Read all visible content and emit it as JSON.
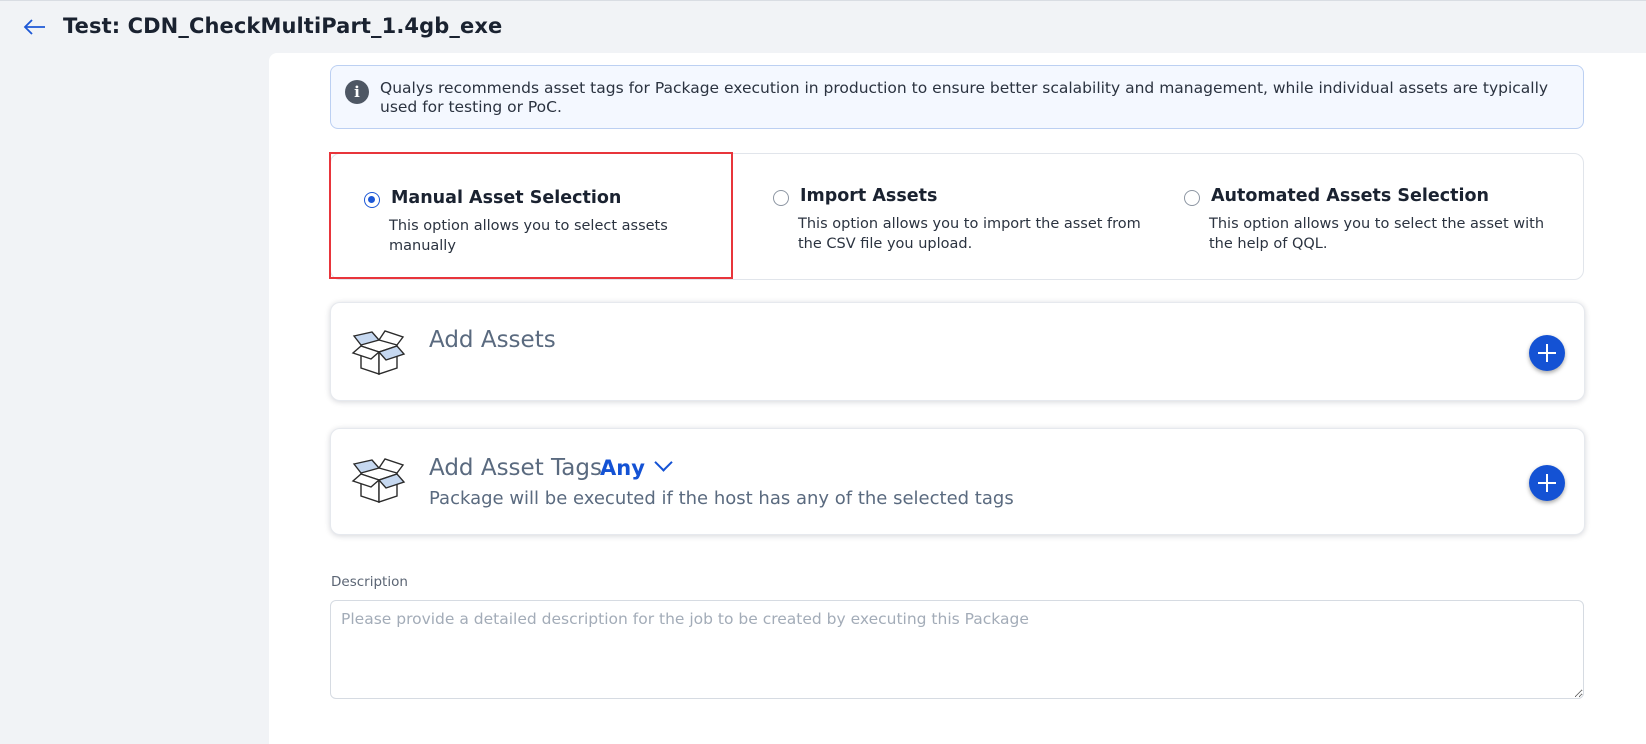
{
  "header": {
    "title": "Test: CDN_CheckMultiPart_1.4gb_exe",
    "back_icon": "arrow-left-icon"
  },
  "info_banner": {
    "icon": "info-icon",
    "text": "Qualys recommends asset tags for Package execution in production to ensure better scalability and management, while individual assets are typically used for testing or PoC."
  },
  "selection_options": [
    {
      "title": "Manual Asset Selection",
      "description": "This option allows you to select assets manually",
      "selected": true
    },
    {
      "title": "Import Assets",
      "description": "This option allows you to import the asset from the CSV file you upload.",
      "selected": false
    },
    {
      "title": "Automated Assets Selection",
      "description": "This option allows you to select the asset with the help of QQL.",
      "selected": false
    }
  ],
  "add_assets": {
    "title": "Add Assets",
    "icon": "open-box-icon",
    "button_icon": "plus-icon"
  },
  "add_asset_tags": {
    "title": "Add Asset Tags",
    "match_mode": "Any",
    "subtitle": "Package will be executed if the host has any of the selected tags",
    "icon": "open-box-icon",
    "button_icon": "plus-icon"
  },
  "description": {
    "label": "Description",
    "placeholder": "Please provide a detailed description for the job to be created by executing this Package",
    "value": ""
  },
  "colors": {
    "accent": "#1452d4",
    "selected_outline": "#e8353b",
    "banner_bg": "#f4f8ff"
  }
}
